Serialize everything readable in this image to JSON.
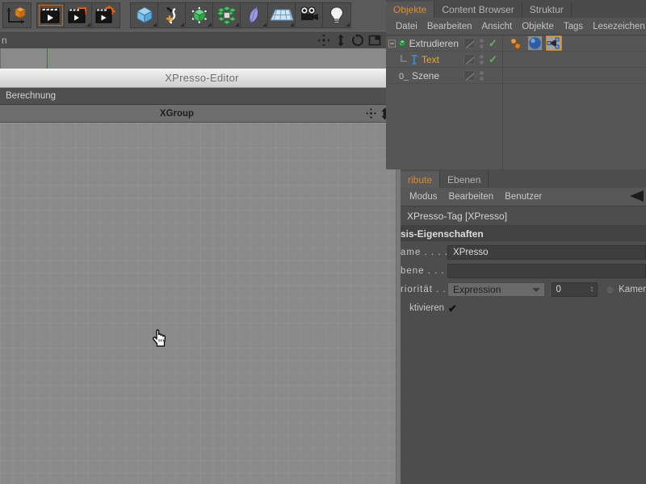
{
  "toolbar": {
    "groups": [
      {
        "name": "transform-group",
        "buttons": [
          {
            "icon": "axis-cube-icon",
            "label": "Objektachse bearbeiten",
            "active": false,
            "corner": false
          }
        ]
      },
      {
        "name": "animation-group",
        "buttons": [
          {
            "icon": "render-view-icon",
            "label": "Ansicht rendern",
            "active": true,
            "corner": false
          },
          {
            "icon": "render-region-icon",
            "label": "Bereich rendern",
            "active": false,
            "corner": true
          },
          {
            "icon": "render-settings-icon",
            "label": "Rendervoreinstellungen",
            "active": false,
            "corner": false
          }
        ]
      },
      {
        "name": "object-group",
        "buttons": [
          {
            "icon": "cube-primitive-icon",
            "label": "Grundobjekte",
            "active": false,
            "corner": true
          },
          {
            "icon": "spline-pen-icon",
            "label": "Spline-Werkzeuge",
            "active": false,
            "corner": true
          },
          {
            "icon": "nurbs-cube-icon",
            "label": "NURBS-Objekte",
            "active": false,
            "corner": true
          },
          {
            "icon": "array-green-icon",
            "label": "Modeling-Objekte",
            "active": false,
            "corner": true
          },
          {
            "icon": "deformer-icon",
            "label": "Deformationsobjekte",
            "active": false,
            "corner": true
          },
          {
            "icon": "floor-grid-icon",
            "label": "Szene-Objekte",
            "active": false,
            "corner": true
          },
          {
            "icon": "camera-icon",
            "label": "Kamera",
            "active": false,
            "corner": false
          },
          {
            "icon": "light-bulb-icon",
            "label": "Licht",
            "active": false,
            "corner": true
          }
        ]
      }
    ]
  },
  "viewport": {
    "title": "n",
    "icons": [
      "move-view-icon",
      "zoom-view-icon",
      "rotate-view-icon",
      "layout-view-icon"
    ]
  },
  "xpresso": {
    "window_title": "XPresso-Editor",
    "menu": [
      "Berechnung"
    ],
    "group_label": "XGroup",
    "group_controls": [
      "move-handle-icon",
      "updown-handle-icon"
    ],
    "group_color": "#d87a72",
    "cursor": "pointing-hand-cursor"
  },
  "object_manager": {
    "tabs": [
      {
        "label": "Objekte",
        "active": true
      },
      {
        "label": "Content Browser",
        "active": false
      },
      {
        "label": "Struktur",
        "active": false
      }
    ],
    "menu": [
      "Datei",
      "Bearbeiten",
      "Ansicht",
      "Objekte",
      "Tags",
      "Lesezeichen"
    ],
    "rows": [
      {
        "name": "Extrudieren",
        "icon": "extrude-nurbs-icon",
        "indent": 0,
        "expander": "minus",
        "checks": 1,
        "tags": [
          "orange-dots-tag-icon",
          "blue-material-tag-icon",
          "xpresso-tag-icon"
        ],
        "selected_tag_index": 2
      },
      {
        "name": "Text",
        "icon": "text-spline-icon",
        "indent": 1,
        "expander": "leaf",
        "checks": 1,
        "tags": [],
        "selected_tag_index": -1,
        "highlighted": true
      },
      {
        "name": "Szene",
        "icon": "scene-icon",
        "indent": 0,
        "expander": "none",
        "checks": 0,
        "tags": [],
        "selected_tag_index": -1
      }
    ]
  },
  "attribute_manager": {
    "tabs": [
      {
        "label": "ribute",
        "active": true
      },
      {
        "label": "Ebenen",
        "active": false
      }
    ],
    "menu": [
      "Modus",
      "Bearbeiten",
      "Benutzer"
    ],
    "object_line": "XPresso-Tag [XPresso]",
    "section_title": "sis-Eigenschaften",
    "fields": [
      {
        "label": "ame . . . .",
        "type": "text",
        "value": "XPresso"
      },
      {
        "label": "bene . . . .",
        "type": "text",
        "value": ""
      },
      {
        "label": "riorität . .",
        "type": "select",
        "value": "Expression",
        "number": "0",
        "checkbox_label": "Kamer",
        "checkbox_checked": false
      },
      {
        "label": "ktivieren",
        "type": "checkbox",
        "value": "✔",
        "checked": true
      }
    ]
  },
  "colors": {
    "accent_orange": "#e08a24",
    "panel_bg": "#4d4d4d",
    "canvas_bg": "#8a8a8a",
    "group_red": "#d87a72",
    "check_green": "#5db85d"
  }
}
